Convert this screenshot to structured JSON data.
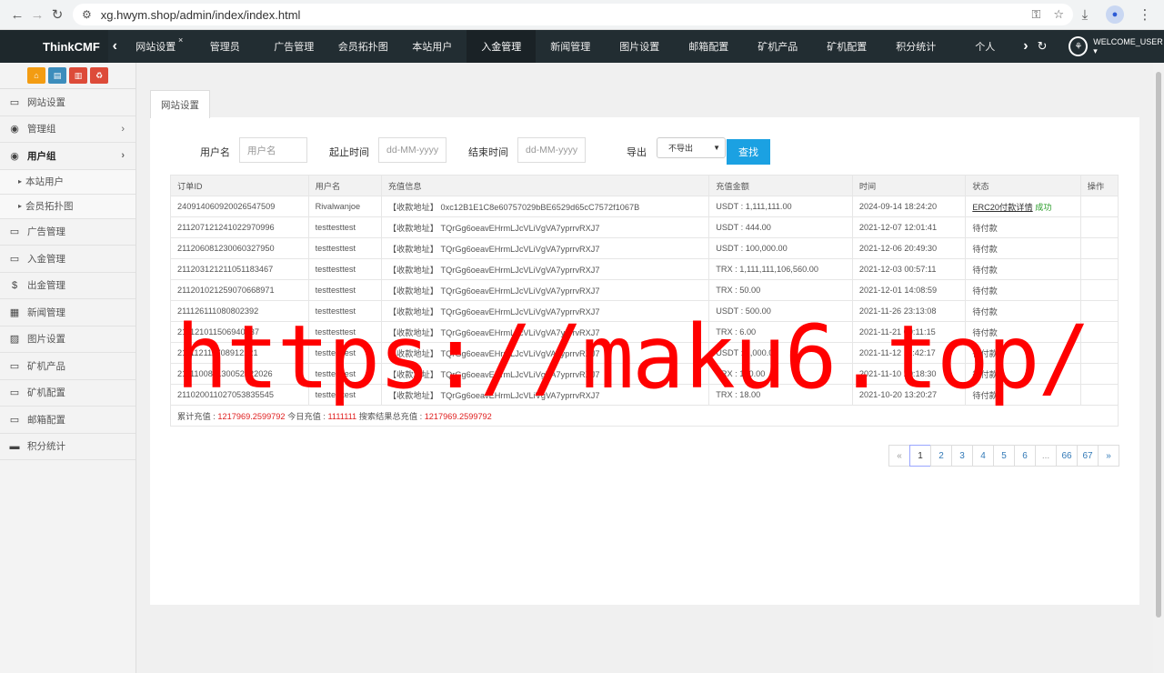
{
  "browser": {
    "url": "xg.hwym.shop/admin/index/index.html"
  },
  "topnav": {
    "brand": "ThinkCMF",
    "tabs": [
      {
        "label": "网站设置",
        "closable": true
      },
      {
        "label": "管理员"
      },
      {
        "label": "广告管理"
      },
      {
        "label": "会员拓扑图"
      },
      {
        "label": "本站用户"
      },
      {
        "label": "入金管理",
        "active": true
      },
      {
        "label": "新闻管理"
      },
      {
        "label": "图片设置"
      },
      {
        "label": "邮箱配置"
      },
      {
        "label": "矿机产品"
      },
      {
        "label": "矿机配置"
      },
      {
        "label": "积分统计"
      },
      {
        "label": "个人"
      }
    ],
    "welcome": "WELCOME_USER ▾"
  },
  "sidebar": {
    "top_buttons": [
      {
        "icon": "home-icon",
        "color": "#f39c12"
      },
      {
        "icon": "file-icon",
        "color": "#3c8dbc"
      },
      {
        "icon": "trash-icon",
        "color": "#dd4b39"
      },
      {
        "icon": "recycle-icon",
        "color": "#dd4b39"
      }
    ],
    "items": [
      {
        "label": "网站设置",
        "icon": "monitor-icon"
      },
      {
        "label": "管理组",
        "icon": "user-circle-icon",
        "chevron": true
      },
      {
        "label": "用户组",
        "icon": "user-circle-icon",
        "chevron": true,
        "bold": true
      },
      {
        "label": "本站用户",
        "sub": true
      },
      {
        "label": "会员拓扑图",
        "sub": true
      },
      {
        "label": "广告管理",
        "icon": "monitor-icon"
      },
      {
        "label": "入金管理",
        "icon": "monitor-icon"
      },
      {
        "label": "出金管理",
        "icon": "dollar-icon"
      },
      {
        "label": "新闻管理",
        "icon": "newspaper-icon"
      },
      {
        "label": "图片设置",
        "icon": "image-icon"
      },
      {
        "label": "矿机产品",
        "icon": "monitor-icon"
      },
      {
        "label": "矿机配置",
        "icon": "monitor-icon"
      },
      {
        "label": "邮箱配置",
        "icon": "monitor-icon"
      },
      {
        "label": "积分统计",
        "icon": "visa-icon"
      }
    ]
  },
  "panel": {
    "tab": "网站设置",
    "filters": {
      "username_label": "用户名",
      "username_placeholder": "用户名",
      "start_label": "起止时间",
      "start_placeholder": "dd-MM-yyyy",
      "end_label": "结束时间",
      "end_placeholder": "dd-MM-yyyy",
      "export_label": "导出",
      "export_value": "不导出",
      "search_button": "查找"
    },
    "table": {
      "headers": [
        "订单ID",
        "用户名",
        "充值信息",
        "充值金额",
        "时间",
        "状态",
        "操作"
      ],
      "rows": [
        {
          "id": "240914060920026547509",
          "user": "Rivalwanjoe",
          "info": "【收款地址】 0xc12B1E1C8e60757029bBE6529d65cC7572f1067B",
          "amount": "USDT : 1,111,111.00",
          "time": "2024-09-14 18:24:20",
          "status_link": "ERC20付款详情",
          "status": "成功"
        },
        {
          "id": "211207121241022970996",
          "user": "testtesttest",
          "info": "【收款地址】 TQrGg6oeavEHrmLJcVLiVgVA7yprrvRXJ7",
          "amount": "USDT : 444.00",
          "time": "2021-12-07 12:01:41",
          "status": "待付款"
        },
        {
          "id": "211206081230060327950",
          "user": "testtesttest",
          "info": "【收款地址】 TQrGg6oeavEHrmLJcVLiVgVA7yprrvRXJ7",
          "amount": "USDT : 100,000.00",
          "time": "2021-12-06 20:49:30",
          "status": "待付款"
        },
        {
          "id": "211203121211051183467",
          "user": "testtesttest",
          "info": "【收款地址】 TQrGg6oeavEHrmLJcVLiVgVA7yprrvRXJ7",
          "amount": "TRX : 1,111,111,106,560.00",
          "time": "2021-12-03 00:57:11",
          "status": "待付款"
        },
        {
          "id": "211201021259070668971",
          "user": "testtesttest",
          "info": "【收款地址】 TQrGg6oeavEHrmLJcVLiVgVA7yprrvRXJ7",
          "amount": "TRX : 50.00",
          "time": "2021-12-01 14:08:59",
          "status": "待付款"
        },
        {
          "id": "211126111080802392",
          "user": "testtesttest",
          "info": "【收款地址】 TQrGg6oeavEHrmLJcVLiVgVA7yprrvRXJ7",
          "amount": "USDT : 500.00",
          "time": "2021-11-26 23:13:08",
          "status": "待付款"
        },
        {
          "id": "211121011506940537",
          "user": "testtesttest",
          "info": "【收款地址】 TQrGg6oeavEHrmLJcVLiVgVA7yprrvRXJ7",
          "amount": "TRX : 6.00",
          "time": "2021-11-21 09:11:15",
          "status": "待付款"
        },
        {
          "id": "211112111708912221",
          "user": "testtesttest",
          "info": "【收款地址】 TQrGg6oeavEHrmLJcVLiVgVA7yprrvRXJ7",
          "amount": "USDT : 1,000.00",
          "time": "2021-11-12 11:42:17",
          "status": "待付款"
        },
        {
          "id": "211110081130052122026",
          "user": "testtesttest",
          "info": "【收款地址】 TQrGg6oeavEHrmLJcVLiVgVA7yprrvRXJ7",
          "amount": "TRX : 100.00",
          "time": "2021-11-10 20:18:30",
          "status": "待付款"
        },
        {
          "id": "211020011027053835545",
          "user": "testtesttest",
          "info": "【收款地址】 TQrGg6oeavEHrmLJcVLiVgVA7yprrvRXJ7",
          "amount": "TRX : 18.00",
          "time": "2021-10-20 13:20:27",
          "status": "待付款"
        }
      ],
      "summary": {
        "total_label": "累计充值 : ",
        "total_value": "1217969.2599792",
        "today_label": " 今日充值 : ",
        "today_value": "1111111",
        "search_label": " 搜索结果总充值 : ",
        "search_value": "1217969.2599792"
      }
    },
    "pager": [
      "«",
      "1",
      "2",
      "3",
      "4",
      "5",
      "6",
      "...",
      "66",
      "67",
      "»"
    ],
    "pager_current": "1"
  },
  "watermark": "https://maku6.top/"
}
